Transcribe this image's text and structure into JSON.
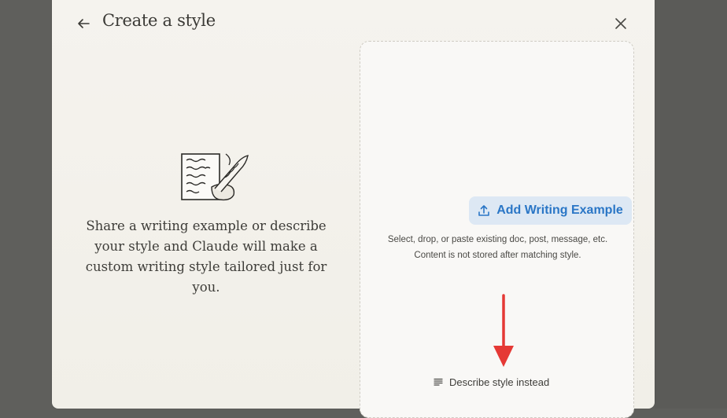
{
  "modal": {
    "title": "Create a style",
    "back_icon": "arrow-left-icon",
    "close_icon": "close-icon"
  },
  "left": {
    "illustration": "writing-quill-illustration",
    "description": "Share a writing example or describe your style and Claude will make a custom writing style tailored just for you."
  },
  "upload": {
    "button_label": "Add Writing Example",
    "button_icon": "upload-icon",
    "hint_line1": "Select, drop, or paste existing doc, post, message, etc.",
    "hint_line2": "Content is not stored after matching style.",
    "describe_label": "Describe style instead",
    "describe_icon": "text-lines-icon"
  },
  "colors": {
    "accent": "#2a76c6",
    "accent_bg": "#dde8f4",
    "annotation_arrow": "#e53935"
  }
}
